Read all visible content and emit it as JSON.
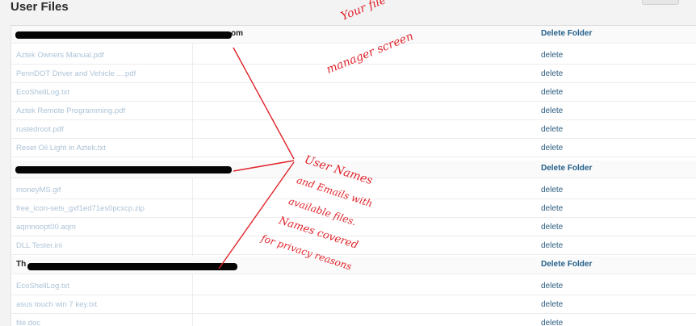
{
  "page": {
    "title": "User Files"
  },
  "users": [
    {
      "name_suffix": "om",
      "action": "Delete Folder",
      "files": [
        {
          "name": "Aztek Owners Manual.pdf",
          "action": "delete"
        },
        {
          "name": "PennDOT Driver and Vehicle ....pdf",
          "action": "delete"
        },
        {
          "name": "EcoShellLog.txt",
          "action": "delete"
        },
        {
          "name": "Aztek Remote Programming.pdf",
          "action": "delete"
        },
        {
          "name": "rustedroot.pdf",
          "action": "delete"
        },
        {
          "name": "Reset Oil Light in Aztek.txt",
          "action": "delete"
        }
      ]
    },
    {
      "name_suffix": "",
      "action": "Delete Folder",
      "files": [
        {
          "name": "moneyMS.gif",
          "action": "delete"
        },
        {
          "name": "free_icon-sets_gxf1ed71es0pcxcp.zip",
          "action": "delete"
        },
        {
          "name": "aqmnoopt00.aqm",
          "action": "delete"
        },
        {
          "name": "DLL Tester.ini",
          "action": "delete"
        }
      ]
    },
    {
      "name_suffix": "Th",
      "action": "Delete Folder",
      "files": [
        {
          "name": "EcoShellLog.txt",
          "action": "delete"
        },
        {
          "name": "asus touch win 7 key.txt",
          "action": "delete"
        },
        {
          "name": "file.doc",
          "action": "delete"
        }
      ]
    }
  ],
  "annotations": {
    "note1_line1": "Your file",
    "note1_line2": "manager screen",
    "note2_line1": "User Names",
    "note2_line2": "and Emails with",
    "note2_line3": "available files.",
    "note2_line4": "Names covered",
    "note2_line5": "for privacy reasons"
  },
  "colors": {
    "annotation": "#e0232a",
    "link": "#2b5c80",
    "file_text": "#aec3d6"
  }
}
